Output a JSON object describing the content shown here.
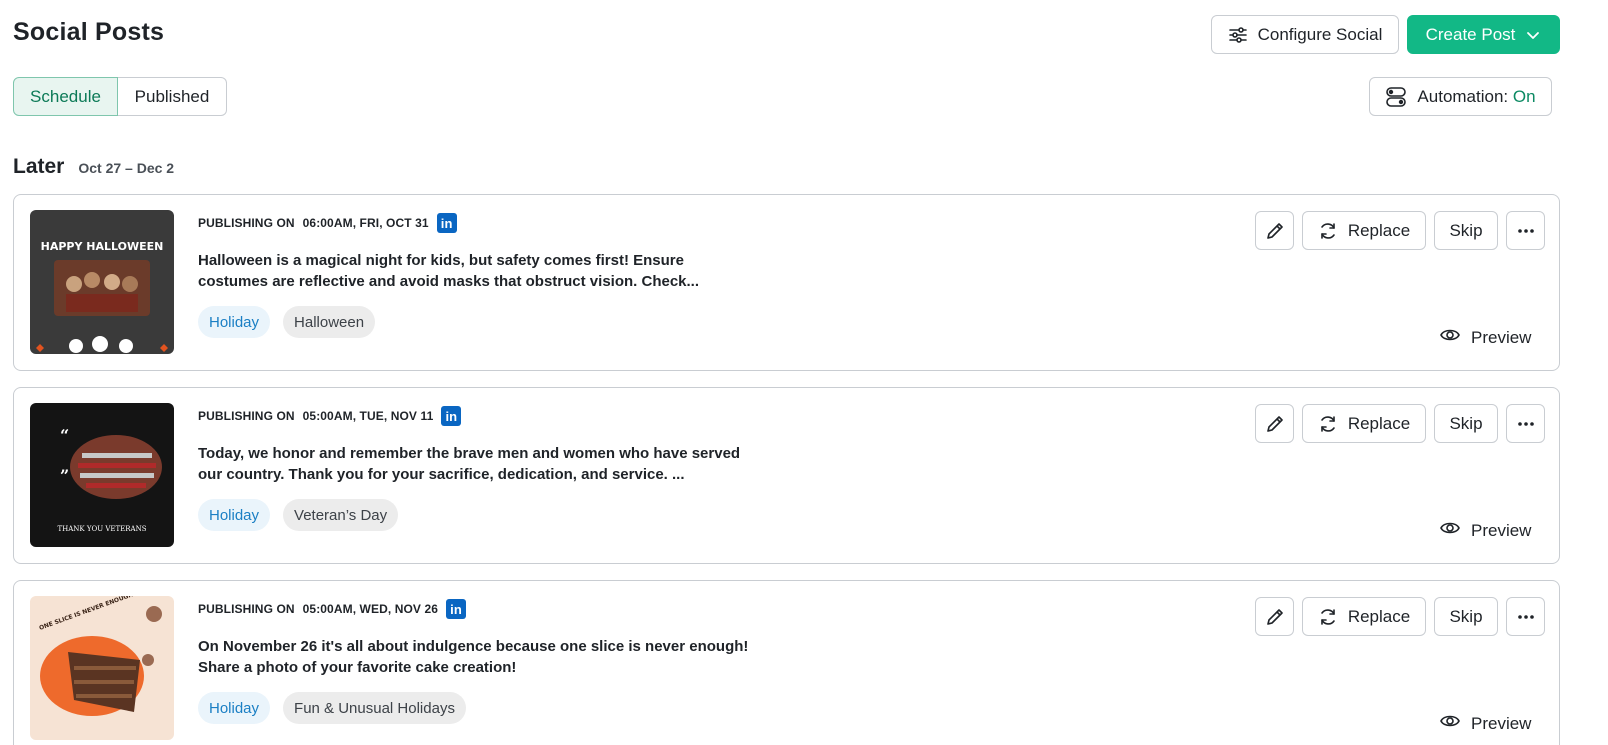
{
  "header": {
    "title": "Social Posts",
    "configure_label": "Configure Social",
    "create_label": "Create Post",
    "automation_label": "Automation:",
    "automation_value": "On"
  },
  "tabs": [
    {
      "label": "Schedule",
      "active": true
    },
    {
      "label": "Published",
      "active": false
    }
  ],
  "section": {
    "title": "Later",
    "range": "Oct 27 – Dec 2"
  },
  "actions": {
    "replace_label": "Replace",
    "skip_label": "Skip",
    "preview_label": "Preview"
  },
  "posts": [
    {
      "publishing_prefix": "PUBLISHING ON",
      "datetime": "06:00AM, FRI, OCT 31",
      "network_icon": "linkedin-icon",
      "text": "Halloween is a magical night for kids, but safety comes first! Ensure costumes are reflective and avoid masks that obstruct vision. Check...",
      "tags": [
        "Holiday",
        "Halloween"
      ],
      "thumb_text": "HAPPY HALLOWEEN"
    },
    {
      "publishing_prefix": "PUBLISHING ON",
      "datetime": "05:00AM, TUE, NOV 11",
      "network_icon": "linkedin-icon",
      "text": "Today, we honor and remember the brave men and women who have served our country. Thank you for your sacrifice, dedication, and service. ...",
      "tags": [
        "Holiday",
        "Veteran’s Day"
      ],
      "thumb_text": "THANK YOU VETERANS"
    },
    {
      "publishing_prefix": "PUBLISHING ON",
      "datetime": "05:00AM, WED, NOV 26",
      "network_icon": "linkedin-icon",
      "text": "On November 26 it's all about indulgence because one slice is never enough! Share a photo of your favorite cake creation!",
      "tags": [
        "Holiday",
        "Fun & Unusual Holidays"
      ],
      "thumb_text": "ONE SLICE IS NEVER ENOUGH"
    }
  ],
  "colors": {
    "accent": "#12b886",
    "linkedin": "#0a66c2",
    "tag_primary": "#1b7fc4"
  }
}
